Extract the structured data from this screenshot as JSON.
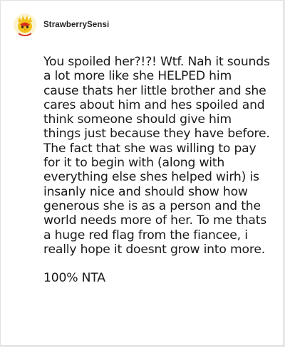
{
  "comment": {
    "author": {
      "username": "StrawberrySensi",
      "avatar_icon": "strawberry-chick-icon"
    },
    "paragraphs": [
      "You spoiled her?!?! Wtf. Nah it sounds a lot more like she HELPED him cause thats her little brother and she cares about him and hes spoiled and think someone should give him things just because they have before. The fact that she was willing to pay for it to begin with (along with everything else shes helped wirh) is insanly nice and should show how generous she is as a person and the world needs more of her. To me thats a huge red flag from the fiancee, i really hope it doesnt grow into more.",
      "100% NTA"
    ]
  },
  "colors": {
    "card_background": "#ffffff",
    "text": "#1a1a1a",
    "avatar_background": "#fbf3d0",
    "avatar_red": "#d8301f",
    "avatar_yellow": "#f2c21b"
  }
}
